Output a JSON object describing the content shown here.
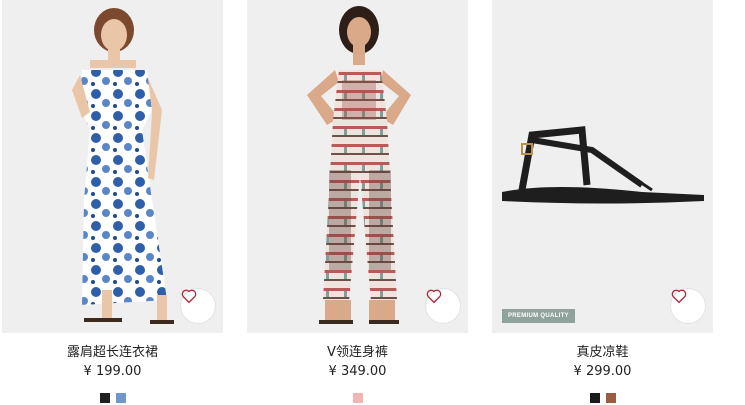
{
  "products": [
    {
      "name": "露肩超长连衣裙",
      "price": "¥ 199.00",
      "swatches": [
        "#1f1f1f",
        "#6f97c9"
      ],
      "favorite_icon": "heart-icon"
    },
    {
      "name": "V领连身裤",
      "price": "¥ 349.00",
      "swatches": [
        "#f3b4b4"
      ],
      "favorite_icon": "heart-icon"
    },
    {
      "name": "真皮凉鞋",
      "price": "¥ 299.00",
      "badge": "PREMIUM QUALITY",
      "swatches": [
        "#1b1b1b",
        "#9a5d42"
      ],
      "favorite_icon": "heart-icon"
    }
  ],
  "colors": {
    "heart": "#b0243b",
    "badge_bg": "#8fa39d"
  }
}
